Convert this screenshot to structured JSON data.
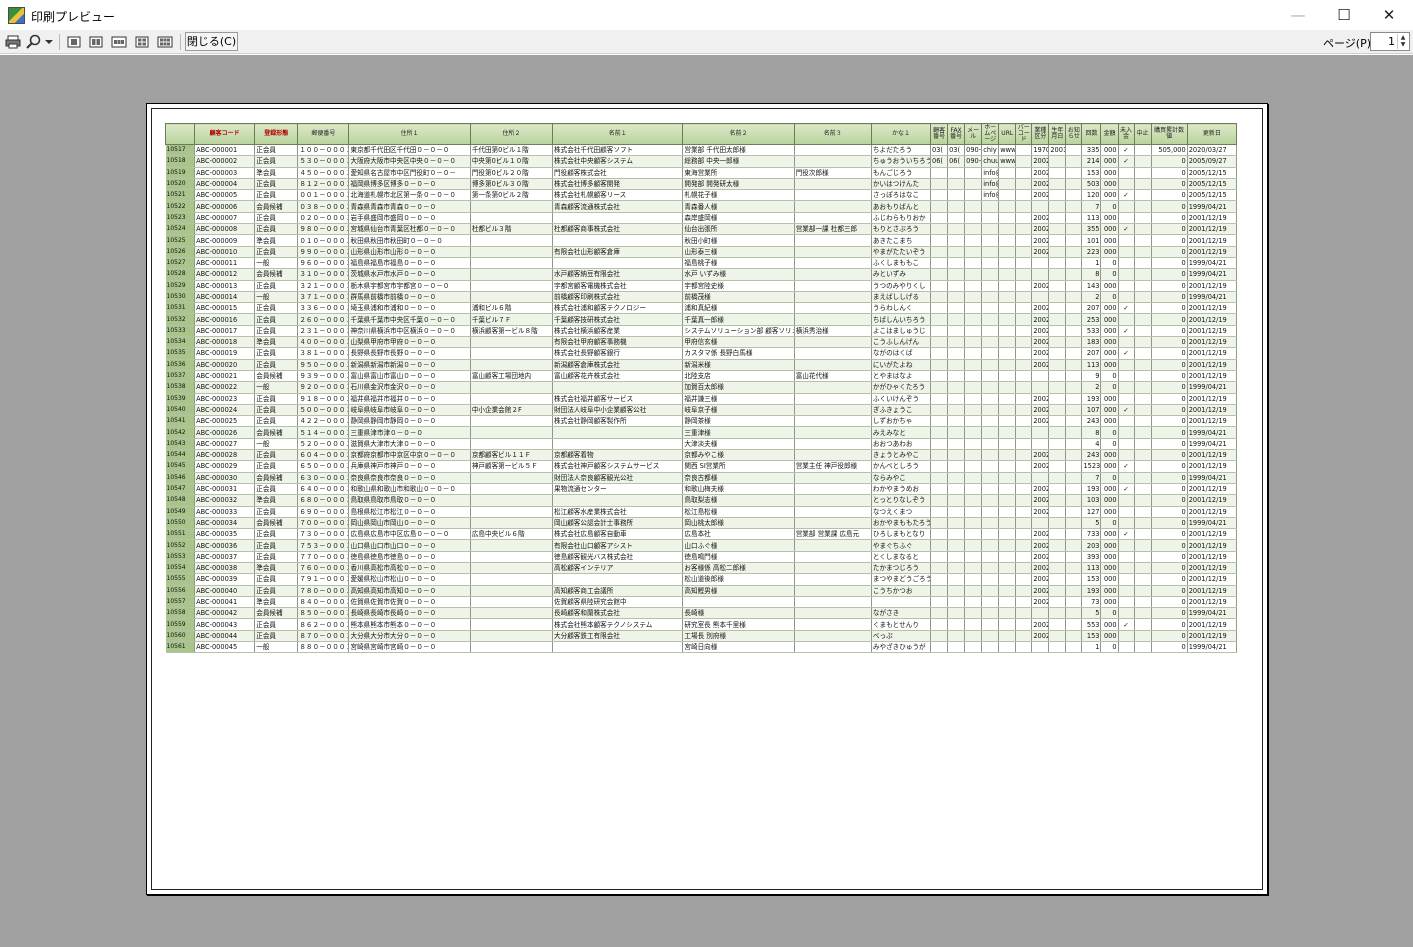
{
  "window": {
    "title": "印刷プレビュー",
    "min": "—",
    "max": "☐",
    "close": "✕"
  },
  "toolbar": {
    "close_label": "閉じる(C)",
    "page_label": "ページ(P)",
    "page_value": "1"
  },
  "columns": [
    "",
    "顧客コード",
    "登録形態",
    "郵便番号",
    "住所１",
    "住所２",
    "名前１",
    "名前２",
    "名前３",
    "かな１",
    "顧客番号",
    "FAX番号",
    "メール",
    "ホームページ",
    "URL",
    "バーコード",
    "業種区分",
    "生年月日",
    "お知らせ",
    "回数",
    "金額",
    "未入金",
    "中止",
    "購買累計数値",
    "更新日"
  ],
  "rows": [
    [
      "10517",
      "ABC-000001",
      "正会員",
      "１００－０００１",
      "東京都千代田区千代田０－０－０",
      "千代田第0ビル１階",
      "株式会社千代田顧客ソフト",
      "営業部 千代田太郎様",
      "",
      "ちよだたろう",
      "03(",
      "03(",
      "090-",
      "chiy",
      "www.",
      "",
      "1970",
      "2001",
      "",
      "335",
      "000",
      "✓",
      "",
      "505,000",
      "2020/03/27"
    ],
    [
      "10518",
      "ABC-000002",
      "正会員",
      "５３０－０００１",
      "大阪府大阪市中央区中央０－０－０",
      "中央第0ビル１０階",
      "株式会社中央顧客システム",
      "総務部 中央一郎様",
      "",
      "ちゅうおういちろう",
      "06(",
      "06(",
      "090-",
      "chuu",
      "www.",
      "",
      "2002",
      "",
      "",
      "214",
      "000",
      "✓",
      "",
      "0",
      "2005/09/27"
    ],
    [
      "10519",
      "ABC-000003",
      "準会員",
      "４５０－０００１",
      "愛知県名古屋市中区門役町０－０－",
      "門役第0ビル２０階",
      "門役顧客株式会社",
      "東海営業所",
      "門役次郎様",
      "もんごじろう",
      "",
      "",
      "",
      "info@",
      "",
      "",
      "2002",
      "",
      "",
      "153",
      "000",
      "",
      "",
      "0",
      "2005/12/15"
    ],
    [
      "10520",
      "ABC-000004",
      "正会員",
      "８１２－０００１",
      "福岡県博多区博多０－０－０",
      "博多第0ビル３０階",
      "株式会社博多顧客開発",
      "開発部 開発研太様",
      "",
      "かいはつけんた",
      "",
      "",
      "",
      "info@",
      "",
      "",
      "2002",
      "",
      "",
      "503",
      "000",
      "",
      "",
      "0",
      "2005/12/15"
    ],
    [
      "10521",
      "ABC-000005",
      "正会員",
      "００１－０００１",
      "北海道札幌市北区第一条０－０－０",
      "第一条第0ビル２階",
      "株式会社札幌顧客リース",
      "札幌花子様",
      "",
      "さっぽろはなこ",
      "",
      "",
      "",
      "info@",
      "",
      "",
      "2002",
      "",
      "",
      "120",
      "000",
      "✓",
      "",
      "0",
      "2005/12/15"
    ],
    [
      "10522",
      "ABC-000006",
      "会員候補",
      "０３８－０００１",
      "青森県青森市青森０－０－０",
      "",
      "青森顧客流通株式会社",
      "青森番人様",
      "",
      "あおもりばんと",
      "",
      "",
      "",
      "",
      "",
      "",
      "",
      "",
      "",
      "7",
      "0",
      "",
      "",
      "0",
      "1999/04/21"
    ],
    [
      "10523",
      "ABC-000007",
      "正会員",
      "０２０－０００１",
      "岩手県盛岡市盛岡０－０－０",
      "",
      "",
      "森岸盛岡様",
      "",
      "ふじわらもりおか",
      "",
      "",
      "",
      "",
      "",
      "",
      "2002",
      "",
      "",
      "113",
      "000",
      "",
      "",
      "0",
      "2001/12/19"
    ],
    [
      "10524",
      "ABC-000008",
      "正会員",
      "９８０－０００１",
      "宮城県仙台市青葉区杜都０－０－０",
      "杜都ビル３階",
      "杜都顧客商事株式会社",
      "仙台出張所",
      "営業部一課 杜都三郎",
      "もりとさぶろう",
      "",
      "",
      "",
      "",
      "",
      "",
      "2002",
      "",
      "",
      "355",
      "000",
      "✓",
      "",
      "0",
      "2001/12/19"
    ],
    [
      "10525",
      "ABC-000009",
      "準会員",
      "０１０－０００１",
      "秋田県秋田市秋田町０－０－０",
      "",
      "",
      "秋田小町様",
      "",
      "あきたこまち",
      "",
      "",
      "",
      "",
      "",
      "",
      "2002",
      "",
      "",
      "101",
      "000",
      "",
      "",
      "0",
      "2001/12/19"
    ],
    [
      "10526",
      "ABC-000010",
      "正会員",
      "９９０－０００１",
      "山形県山形市山形０－０－０",
      "",
      "有限会社山形顧客倉庫",
      "山形泰三様",
      "",
      "やまがたたいぞう",
      "",
      "",
      "",
      "",
      "",
      "",
      "2002",
      "",
      "",
      "223",
      "000",
      "",
      "",
      "0",
      "2001/12/19"
    ],
    [
      "10527",
      "ABC-000011",
      "一般",
      "９６０－０００１",
      "福島県福島市福島０－０－０",
      "",
      "",
      "福島桃子様",
      "",
      "ふくしまももこ",
      "",
      "",
      "",
      "",
      "",
      "",
      "",
      "",
      "",
      "1",
      "0",
      "",
      "",
      "0",
      "1999/04/21"
    ],
    [
      "10528",
      "ABC-000012",
      "会員候補",
      "３１０－０００１",
      "茨城県水戸市水戸０－０－０",
      "",
      "水戸顧客納豆有限会社",
      "水戸 いずみ様",
      "",
      "みといずみ",
      "",
      "",
      "",
      "",
      "",
      "",
      "",
      "",
      "",
      "8",
      "0",
      "",
      "",
      "0",
      "1999/04/21"
    ],
    [
      "10529",
      "ABC-000013",
      "正会員",
      "３２１－０００１",
      "栃木県宇都宮市宇都宮０－０－０",
      "",
      "宇都宮顧客電機株式会社",
      "宇都宮陸史様",
      "",
      "うつのみやりくし",
      "",
      "",
      "",
      "",
      "",
      "",
      "2002",
      "",
      "",
      "143",
      "000",
      "",
      "",
      "0",
      "2001/12/19"
    ],
    [
      "10530",
      "ABC-000014",
      "一般",
      "３７１－０００１",
      "群馬県前橋市前橋０－０－０",
      "",
      "前橋顧客印刷株式会社",
      "前橋茂様",
      "",
      "まえばししげる",
      "",
      "",
      "",
      "",
      "",
      "",
      "",
      "",
      "",
      "2",
      "0",
      "",
      "",
      "0",
      "1999/04/21"
    ],
    [
      "10531",
      "ABC-000015",
      "正会員",
      "３３６－０００１",
      "埼玉県浦和市浦和０－０－０",
      "浦和ビル６階",
      "株式会社浦和顧客テクノロジー",
      "浦和真紀様",
      "",
      "うらわしんく",
      "",
      "",
      "",
      "",
      "",
      "",
      "2002",
      "",
      "",
      "207",
      "000",
      "✓",
      "",
      "0",
      "2001/12/19"
    ],
    [
      "10532",
      "ABC-000016",
      "正会員",
      "２６０－０００１",
      "千葉県千葉市中央区千葉０－０－０",
      "千葉ビル７Ｆ",
      "千葉顧客技研株式会社",
      "千葉真一郎様",
      "",
      "ちばしんいちろう",
      "",
      "",
      "",
      "",
      "",
      "",
      "2002",
      "",
      "",
      "253",
      "000",
      "",
      "",
      "0",
      "2001/12/19"
    ],
    [
      "10533",
      "ABC-000017",
      "正会員",
      "２３１－０００１",
      "神奈川県横浜市中区横浜０－０－０",
      "横浜顧客第一ビル８階",
      "株式会社横浜顧客産業",
      "システムソリューション部 顧客ソリュ",
      "横浜秀治様",
      "よこはましゅうじ",
      "",
      "",
      "",
      "",
      "",
      "",
      "2002",
      "",
      "",
      "533",
      "000",
      "✓",
      "",
      "0",
      "2001/12/19"
    ],
    [
      "10534",
      "ABC-000018",
      "準会員",
      "４００－０００１",
      "山梨県甲府市甲府０－０－０",
      "",
      "有限会社甲府顧客事務機",
      "甲府信玄様",
      "",
      "こうふしんげん",
      "",
      "",
      "",
      "",
      "",
      "",
      "2002",
      "",
      "",
      "183",
      "000",
      "",
      "",
      "0",
      "2001/12/19"
    ],
    [
      "10535",
      "ABC-000019",
      "正会員",
      "３８１－０００１",
      "長野県長野市長野０－０－０",
      "",
      "株式会社長野顧客銀行",
      "カスタマ係 長野白馬様",
      "",
      "ながのはくば",
      "",
      "",
      "",
      "",
      "",
      "",
      "2002",
      "",
      "",
      "207",
      "000",
      "✓",
      "",
      "0",
      "2001/12/19"
    ],
    [
      "10536",
      "ABC-000020",
      "正会員",
      "９５０－０００１",
      "新潟県新潟市新潟０－０－０",
      "",
      "新潟顧客倉庫株式会社",
      "新潟米様",
      "",
      "にいがたよね",
      "",
      "",
      "",
      "",
      "",
      "",
      "2002",
      "",
      "",
      "113",
      "000",
      "",
      "",
      "0",
      "2001/12/19"
    ],
    [
      "10537",
      "ABC-000021",
      "会員候補",
      "９３９－０００１",
      "富山県富山市富山０－０－０",
      "富山顧客工場団地内",
      "富山顧客花卉株式会社",
      "北陸支店",
      "富山花代様",
      "とやまはなよ",
      "",
      "",
      "",
      "",
      "",
      "",
      "",
      "",
      "",
      "9",
      "0",
      "",
      "",
      "0",
      "2001/12/19"
    ],
    [
      "10538",
      "ABC-000022",
      "一般",
      "９２０－０００１",
      "石川県金沢市金沢０－０－０",
      "",
      "",
      "加賀百太郎様",
      "",
      "かがひゃくたろう",
      "",
      "",
      "",
      "",
      "",
      "",
      "",
      "",
      "",
      "2",
      "0",
      "",
      "",
      "0",
      "1999/04/21"
    ],
    [
      "10539",
      "ABC-000023",
      "正会員",
      "９１８－０００１",
      "福井県福井市福井０－０－０",
      "",
      "株式会社福井顧客サービス",
      "福井謙三様",
      "",
      "ふくいけんぞう",
      "",
      "",
      "",
      "",
      "",
      "",
      "2002",
      "",
      "",
      "193",
      "000",
      "",
      "",
      "0",
      "2001/12/19"
    ],
    [
      "10540",
      "ABC-000024",
      "正会員",
      "５００－０００１",
      "岐阜県岐阜市岐阜０－０－０",
      "中小企業会館２F",
      "財団法人岐阜中小企業顧客公社",
      "岐阜京子様",
      "",
      "ぎふきょうこ",
      "",
      "",
      "",
      "",
      "",
      "",
      "2002",
      "",
      "",
      "107",
      "000",
      "✓",
      "",
      "0",
      "2001/12/19"
    ],
    [
      "10541",
      "ABC-000025",
      "正会員",
      "４２２－０００１",
      "静岡県静岡市静岡０－０－０",
      "",
      "株式会社静岡顧客製作所",
      "静岡茶様",
      "",
      "しずおかちゃ",
      "",
      "",
      "",
      "",
      "",
      "",
      "2002",
      "",
      "",
      "243",
      "000",
      "",
      "",
      "0",
      "2001/12/19"
    ],
    [
      "10542",
      "ABC-000026",
      "会員候補",
      "５１４－０００１",
      "三重県津市津０－０－０",
      "",
      "",
      "三重津様",
      "",
      "みえみなと",
      "",
      "",
      "",
      "",
      "",
      "",
      "",
      "",
      "",
      "8",
      "0",
      "",
      "",
      "0",
      "1999/04/21"
    ],
    [
      "10543",
      "ABC-000027",
      "一般",
      "５２０－０００１",
      "滋賀県大津市大津０－０－０",
      "",
      "",
      "大津淡夫様",
      "",
      "おおつあわお",
      "",
      "",
      "",
      "",
      "",
      "",
      "",
      "",
      "",
      "4",
      "0",
      "",
      "",
      "0",
      "1999/04/21"
    ],
    [
      "10544",
      "ABC-000028",
      "正会員",
      "６０４－０００１",
      "京都府京都市中京区中京０－０－０",
      "京都顧客ビル１１Ｆ",
      "京都顧客着物",
      "京都みやこ様",
      "",
      "きょうとみやこ",
      "",
      "",
      "",
      "",
      "",
      "",
      "2002",
      "",
      "",
      "243",
      "000",
      "",
      "",
      "0",
      "2001/12/19"
    ],
    [
      "10545",
      "ABC-000029",
      "正会員",
      "６５０－０００１",
      "兵庫県神戸市神戸０－０－０",
      "神戸顧客第一ビル５Ｆ",
      "株式会社神戸顧客システムサービス",
      "関西 SI営業所",
      "営業主任 神戸役郎様",
      "かんべとしろう",
      "",
      "",
      "",
      "",
      "",
      "",
      "2002",
      "",
      "",
      "1523",
      "000",
      "✓",
      "",
      "0",
      "2001/12/19"
    ],
    [
      "10546",
      "ABC-000030",
      "会員候補",
      "６３０－０００１",
      "奈良県奈良市奈良０－０－０",
      "",
      "財団法人奈良顧客観光公社",
      "奈良古都様",
      "",
      "ならみやこ",
      "",
      "",
      "",
      "",
      "",
      "",
      "",
      "",
      "",
      "7",
      "0",
      "",
      "",
      "0",
      "1999/04/21"
    ],
    [
      "10547",
      "ABC-000031",
      "正会員",
      "６４０－０００１",
      "和歌山県和歌山市和歌山０－０－０",
      "",
      "果物流通センター",
      "和歌山梅夫様",
      "",
      "わかやまうめお",
      "",
      "",
      "",
      "",
      "",
      "",
      "2002",
      "",
      "",
      "193",
      "000",
      "✓",
      "",
      "0",
      "2001/12/19"
    ],
    [
      "10548",
      "ABC-000032",
      "準会員",
      "６８０－０００１",
      "鳥取県鳥取市鳥取０－０－０",
      "",
      "",
      "鳥取梨志様",
      "",
      "とっとりなしぞう",
      "",
      "",
      "",
      "",
      "",
      "",
      "2002",
      "",
      "",
      "103",
      "000",
      "",
      "",
      "0",
      "2001/12/19"
    ],
    [
      "10549",
      "ABC-000033",
      "正会員",
      "６９０－０００１",
      "島根県松江市松江０－０－０",
      "",
      "松江顧客水産業株式会社",
      "松江島松様",
      "",
      "なつえくまつ",
      "",
      "",
      "",
      "",
      "",
      "",
      "2002",
      "",
      "",
      "127",
      "000",
      "",
      "",
      "0",
      "2001/12/19"
    ],
    [
      "10550",
      "ABC-000034",
      "会員候補",
      "７００－０００１",
      "岡山県岡山市岡山０－０－０",
      "",
      "岡山顧客公認会計士事務所",
      "岡山桃太郎様",
      "",
      "おかやまももたろう",
      "",
      "",
      "",
      "",
      "",
      "",
      "",
      "",
      "",
      "5",
      "0",
      "",
      "",
      "0",
      "1999/04/21"
    ],
    [
      "10551",
      "ABC-000035",
      "正会員",
      "７３０－０００１",
      "広島県広島市中区広島０－０－０",
      "広島中央ビル６階",
      "株式会社広島顧客自動車",
      "広島本社",
      "営業部 営業課 広島元",
      "ひろしまもとなり",
      "",
      "",
      "",
      "",
      "",
      "",
      "2002",
      "",
      "",
      "733",
      "000",
      "✓",
      "",
      "0",
      "2001/12/19"
    ],
    [
      "10552",
      "ABC-000036",
      "正会員",
      "７５３－０００１",
      "山口県山口市山口０－０－０",
      "",
      "有限会社山口顧客アシスト",
      "山口ふぐ様",
      "",
      "やまぐちふぐ",
      "",
      "",
      "",
      "",
      "",
      "",
      "2002",
      "",
      "",
      "203",
      "000",
      "",
      "",
      "0",
      "2001/12/19"
    ],
    [
      "10553",
      "ABC-000037",
      "正会員",
      "７７０－０００１",
      "徳島県徳島市徳島０－０－０",
      "",
      "徳島顧客観光バス株式会社",
      "徳島鳴門様",
      "",
      "とくしまなると",
      "",
      "",
      "",
      "",
      "",
      "",
      "2002",
      "",
      "",
      "393",
      "000",
      "",
      "",
      "0",
      "2001/12/19"
    ],
    [
      "10554",
      "ABC-000038",
      "準会員",
      "７６０－０００１",
      "香川県高松市高松０－０－０",
      "",
      "高松顧客インテリア",
      "お客様係 高松二郎様",
      "",
      "たかまつじろう",
      "",
      "",
      "",
      "",
      "",
      "",
      "2002",
      "",
      "",
      "113",
      "000",
      "",
      "",
      "0",
      "2001/12/19"
    ],
    [
      "10555",
      "ABC-000039",
      "正会員",
      "７９１－０００１",
      "愛媛県松山市松山０－０－０",
      "",
      "",
      "松山道後郎様",
      "",
      "まつやまどうごろう",
      "",
      "",
      "",
      "",
      "",
      "",
      "2002",
      "",
      "",
      "153",
      "000",
      "",
      "",
      "0",
      "2001/12/19"
    ],
    [
      "10556",
      "ABC-000040",
      "正会員",
      "７８０－０００１",
      "高知県高知市高知０－０－０",
      "",
      "高知顧客商工会議所",
      "高知鰹男様",
      "",
      "こうちかつお",
      "",
      "",
      "",
      "",
      "",
      "",
      "2002",
      "",
      "",
      "193",
      "000",
      "",
      "",
      "0",
      "2001/12/19"
    ],
    [
      "10557",
      "ABC-000041",
      "準会員",
      "８４０－０００１",
      "佐賀県佐賀市佐賀０－０－０",
      "",
      "佐賀顧客県陸研究会館中",
      "",
      "",
      "",
      "",
      "",
      "",
      "",
      "",
      "",
      "2002",
      "",
      "",
      "73",
      "000",
      "",
      "",
      "0",
      "2001/12/19"
    ],
    [
      "10558",
      "ABC-000042",
      "会員候補",
      "８５０－０００１",
      "長崎県長崎市長崎０－０－０",
      "",
      "長崎顧客和蘭株式会社",
      "長崎様",
      "",
      "ながさき",
      "",
      "",
      "",
      "",
      "",
      "",
      "",
      "",
      "",
      "5",
      "0",
      "",
      "",
      "0",
      "1999/04/21"
    ],
    [
      "10559",
      "ABC-000043",
      "正会員",
      "８６２－０００１",
      "熊本県熊本市熊本０－０－０",
      "",
      "株式会社熊本顧客テクノシステム",
      "研究室長 熊本千里様",
      "",
      "くまもとせんり",
      "",
      "",
      "",
      "",
      "",
      "",
      "2002",
      "",
      "",
      "553",
      "000",
      "✓",
      "",
      "0",
      "2001/12/19"
    ],
    [
      "10560",
      "ABC-000044",
      "正会員",
      "８７０－０００１",
      "大分県大分市大分０－０－０",
      "",
      "大分顧客鉄工有限会社",
      "工場長 別府様",
      "",
      "べっぷ",
      "",
      "",
      "",
      "",
      "",
      "",
      "2002",
      "",
      "",
      "153",
      "000",
      "",
      "",
      "0",
      "2001/12/19"
    ],
    [
      "10561",
      "ABC-000045",
      "一般",
      "８８０－０００１",
      "宮崎県宮崎市宮崎０－０－０",
      "",
      "",
      "宮崎日向様",
      "",
      "みやざきひゅうが",
      "",
      "",
      "",
      "",
      "",
      "",
      "",
      "",
      "",
      "1",
      "0",
      "",
      "",
      "0",
      "1999/04/21"
    ]
  ]
}
